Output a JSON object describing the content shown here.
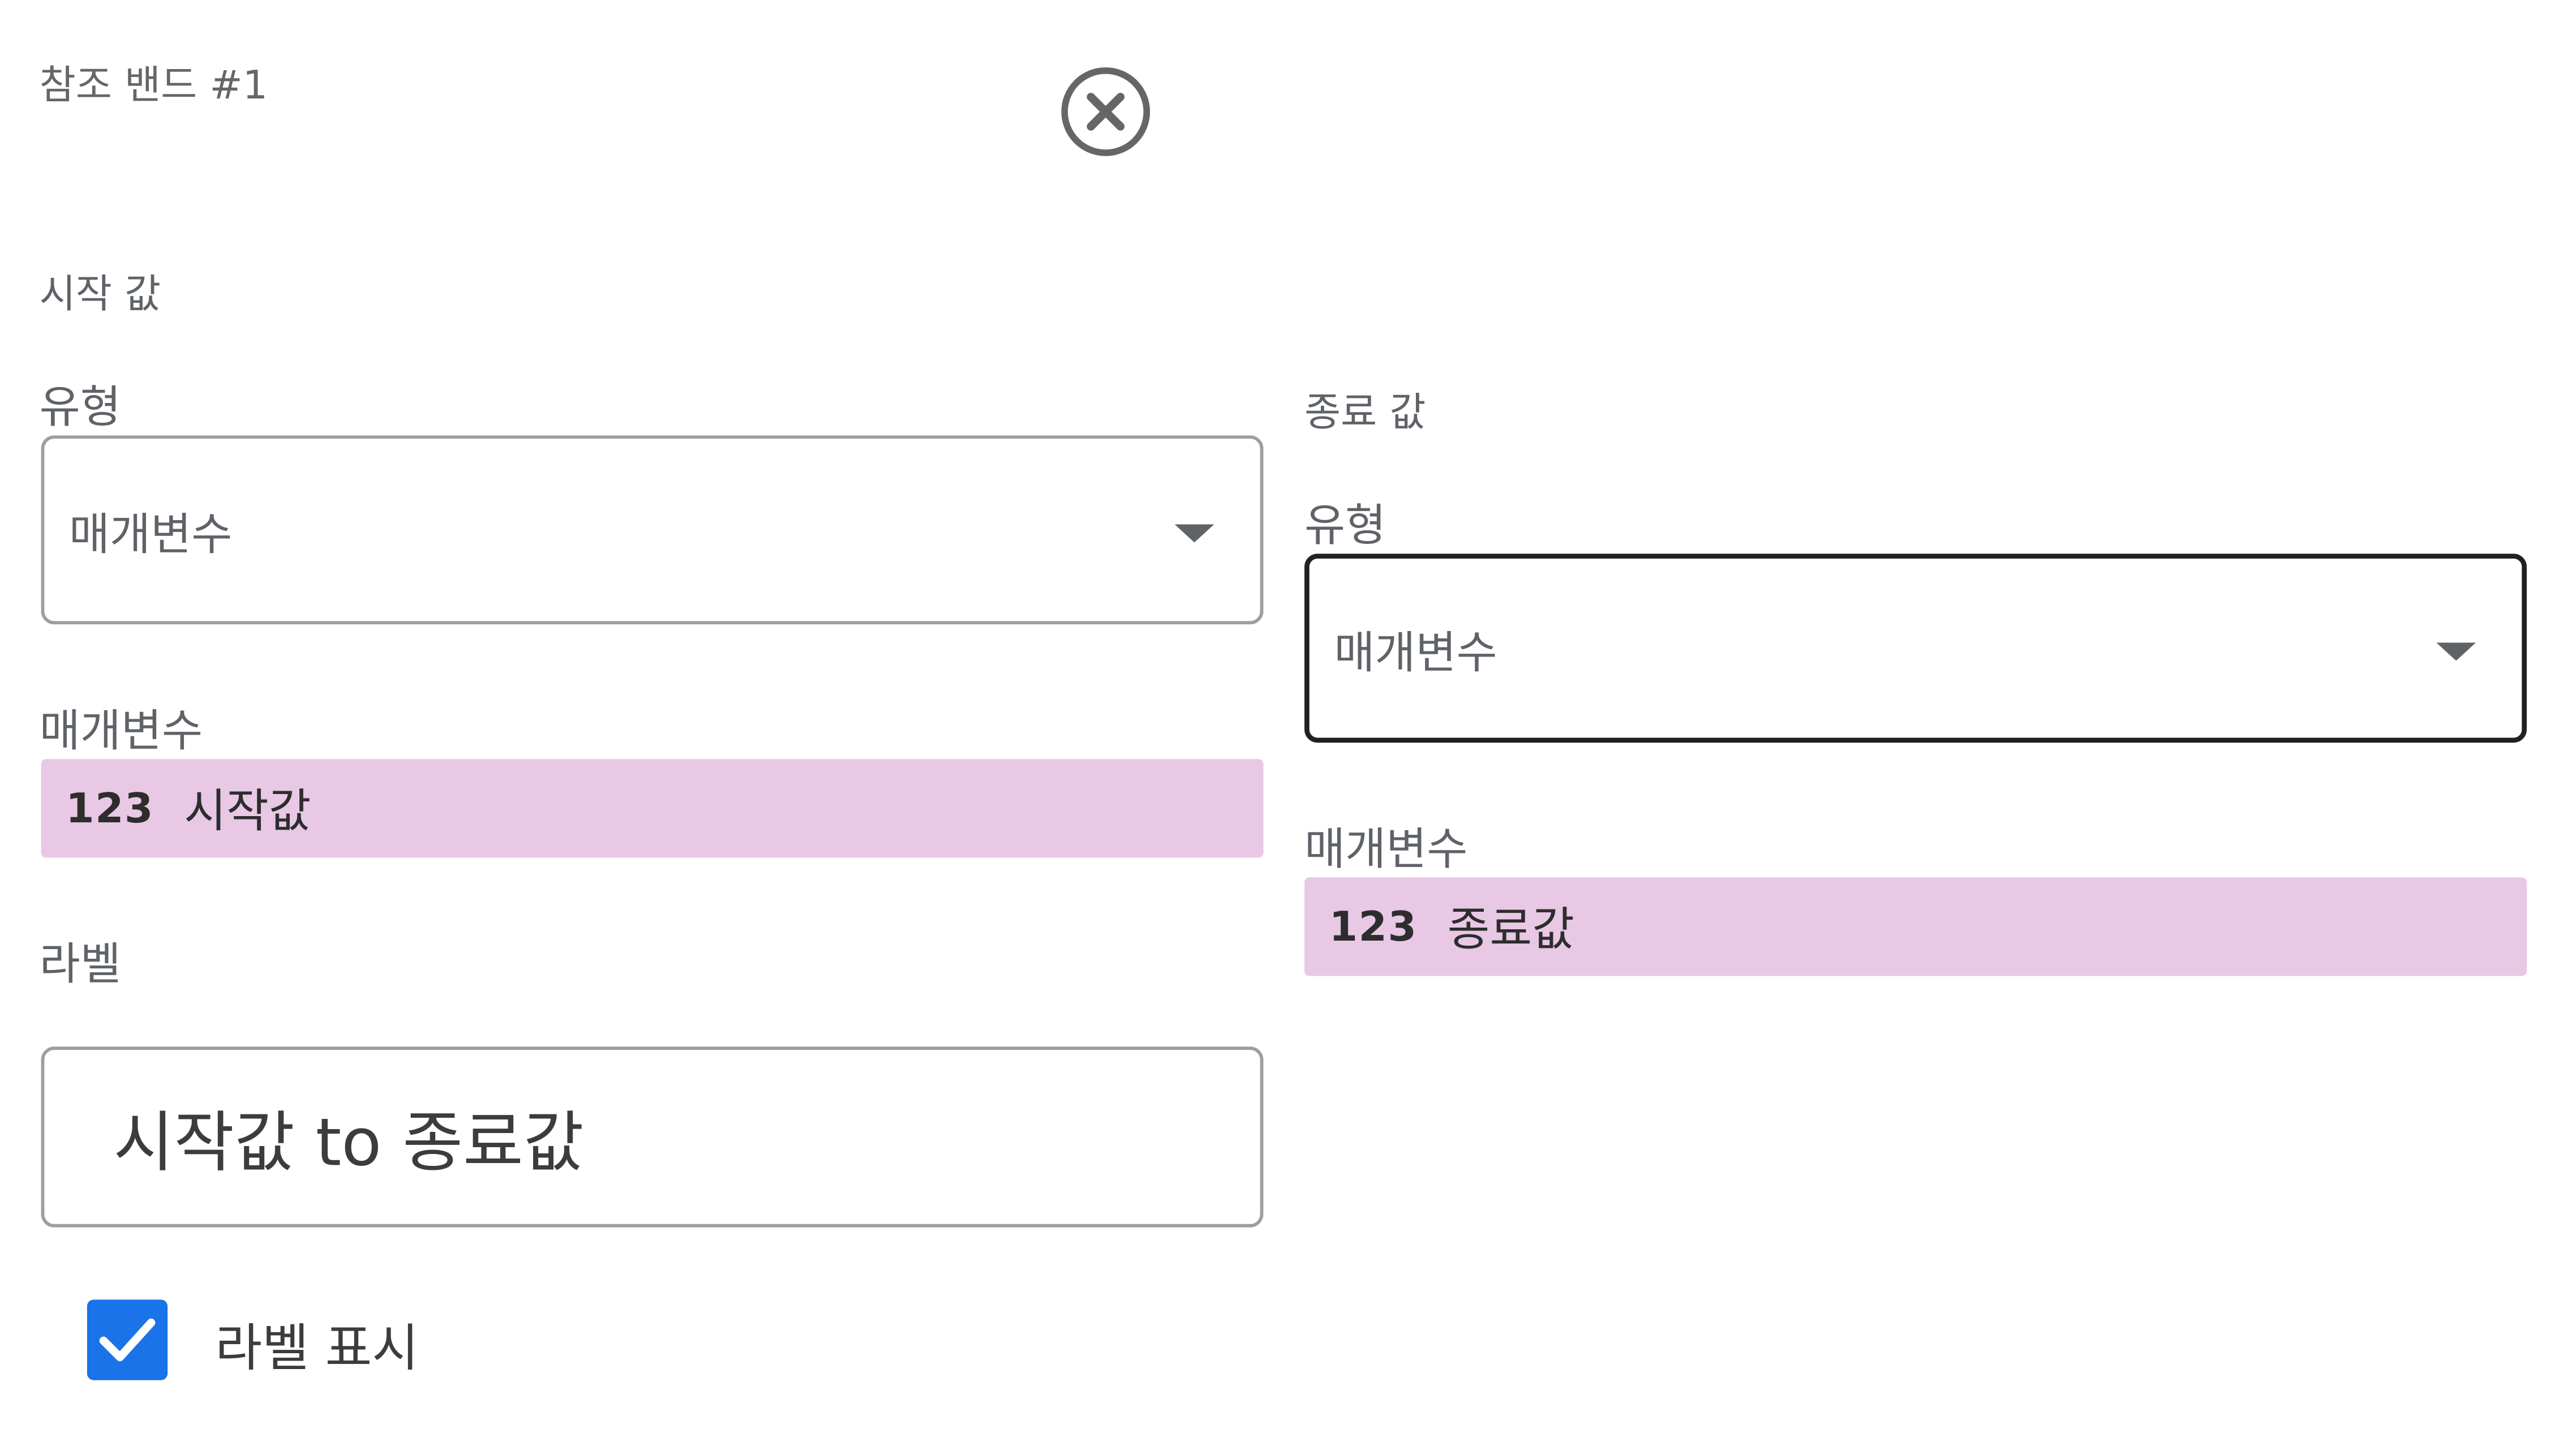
{
  "band": {
    "title": "참조 밴드 #1",
    "close_icon": "close-circle-icon"
  },
  "start": {
    "section_label": "시작 값",
    "type_label": "유형",
    "type_value": "매개변수",
    "param_label": "매개변수",
    "param_type_badge": "123",
    "param_name": "시작값"
  },
  "end": {
    "section_label": "종료 값",
    "type_label": "유형",
    "type_value": "매개변수",
    "param_label": "매개변수",
    "param_type_badge": "123",
    "param_name": "종료값"
  },
  "label": {
    "field_label": "라벨",
    "value": "시작값 to 종료값"
  },
  "show_label": {
    "checked": true,
    "text": "라벨 표시",
    "icon": "checkmark-icon"
  },
  "colors": {
    "checkbox": "#1a73e8",
    "chip_background": "#e8c8e4"
  }
}
